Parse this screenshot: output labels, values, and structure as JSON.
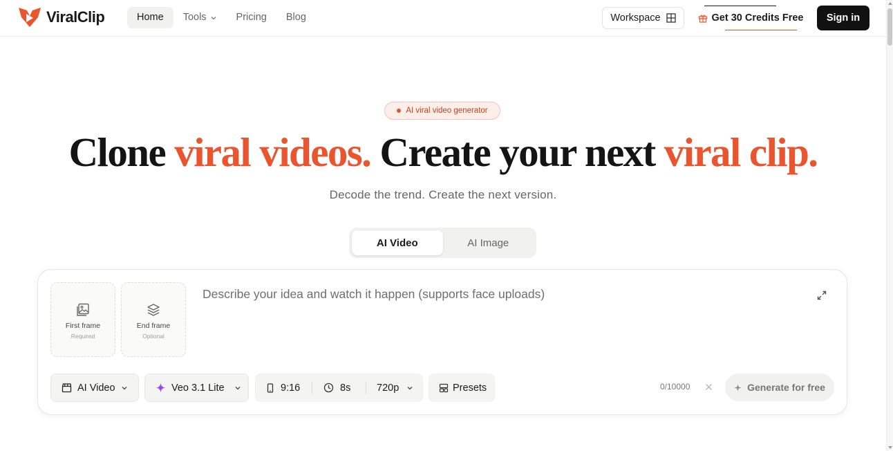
{
  "brand": {
    "name": "ViralClip",
    "accent_color": "#e8552f",
    "logo_icon": "viralclip-logo-mark"
  },
  "nav": {
    "items": [
      {
        "label": "Home",
        "active": true
      },
      {
        "label": "Tools",
        "has_dropdown": true
      },
      {
        "label": "Pricing"
      },
      {
        "label": "Blog"
      }
    ]
  },
  "header_actions": {
    "workspace_label": "Workspace",
    "workspace_icon": "grid-icon",
    "credits_label": "Get 30 Credits Free",
    "credits_icon": "gift-icon",
    "signin_label": "Sign in"
  },
  "hero": {
    "badge": "AI viral video generator",
    "headline": {
      "part1": "Clone ",
      "part2": "viral videos.",
      "part3": " Create your next ",
      "part4": "viral clip."
    },
    "subtitle": "Decode the trend. Create the next version."
  },
  "mode_toggle": {
    "tabs": [
      {
        "label": "AI Video",
        "active": true
      },
      {
        "label": "AI Image",
        "active": false
      }
    ]
  },
  "composer": {
    "first_frame": {
      "title": "First frame",
      "sub": "Required",
      "icon": "image-upload-icon"
    },
    "end_frame": {
      "title": "End frame",
      "sub": "Optional",
      "icon": "layers-icon"
    },
    "prompt_placeholder": "Describe your idea and watch it happen (supports face uploads)",
    "prompt_value": "",
    "toolbar": {
      "type_label": "AI Video",
      "model_label": "Veo 3.1 Lite",
      "aspect_ratio": "9:16",
      "duration": "8s",
      "resolution": "720p",
      "presets_label": "Presets"
    },
    "char_counter": "0/10000",
    "generate_label": "Generate for free"
  }
}
